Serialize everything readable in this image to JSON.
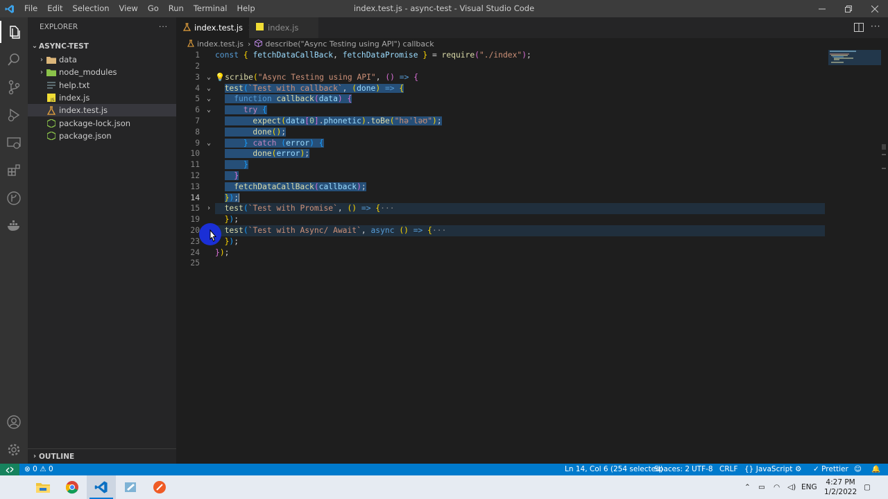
{
  "window": {
    "title": "index.test.js - async-test - Visual Studio Code",
    "menu": [
      "File",
      "Edit",
      "Selection",
      "View",
      "Go",
      "Run",
      "Terminal",
      "Help"
    ]
  },
  "sidebar": {
    "header": "EXPLORER",
    "more": "···",
    "folder": "ASYNC-TEST",
    "items": [
      {
        "label": "data",
        "kind": "folder",
        "color": "#cccccc"
      },
      {
        "label": "node_modules",
        "kind": "folder",
        "color": "#cccccc"
      },
      {
        "label": "help.txt",
        "kind": "txt",
        "color": "#cccccc"
      },
      {
        "label": "index.js",
        "kind": "js",
        "color": "#cccccc"
      },
      {
        "label": "index.test.js",
        "kind": "test",
        "color": "#cccccc"
      },
      {
        "label": "package-lock.json",
        "kind": "json",
        "color": "#cccccc"
      },
      {
        "label": "package.json",
        "kind": "json",
        "color": "#cccccc"
      }
    ],
    "outline": "OUTLINE"
  },
  "tabs": {
    "active": "index.test.js",
    "inactive": "index.js"
  },
  "breadcrumb": {
    "file": "index.test.js",
    "symbol": "describe(\"Async Testing using API\") callback"
  },
  "editor": {
    "line_numbers": [
      "1",
      "2",
      "3",
      "4",
      "5",
      "6",
      "7",
      "8",
      "9",
      "10",
      "11",
      "12",
      "13",
      "14",
      "15",
      "19",
      "20",
      "23",
      "24",
      "25"
    ],
    "active_line": "14"
  },
  "statusbar": {
    "problems": "0",
    "warnings": "0",
    "position": "Ln 14, Col 6 (254 selected)",
    "spaces": "Spaces: 2",
    "encoding": "UTF-8",
    "eol": "CRLF",
    "language": "JavaScript",
    "formatter": "Prettier"
  },
  "taskbar": {
    "lang": "ENG",
    "time": "4:27 PM",
    "date": "1/2/2022"
  },
  "colors": {
    "accent": "#007acc",
    "remote": "#16825d",
    "selection": "#264f78"
  }
}
